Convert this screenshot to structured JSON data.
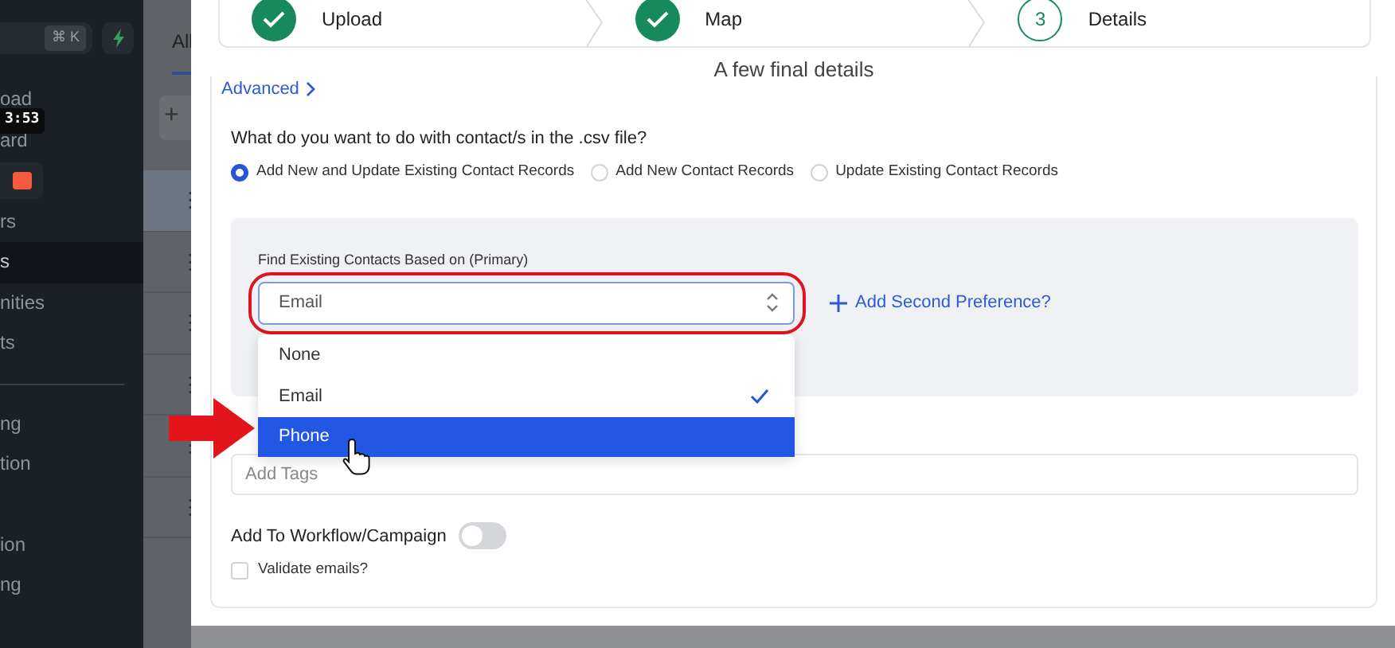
{
  "sidebar": {
    "shortcut": "⌘ K",
    "sections": [
      {
        "divider": false,
        "items": [
          {
            "kind": "text",
            "label": "oad",
            "selected": false
          },
          {
            "kind": "text",
            "label": "ard",
            "selected": false
          },
          {
            "kind": "square",
            "selected": false
          },
          {
            "kind": "text",
            "label": "rs",
            "selected": false
          },
          {
            "kind": "text",
            "label": "s",
            "selected": true
          },
          {
            "kind": "text",
            "label": "nities",
            "selected": false
          },
          {
            "kind": "text",
            "label": "ts",
            "selected": false
          }
        ]
      },
      {
        "divider": true,
        "items": [
          {
            "kind": "text",
            "label": "ng",
            "selected": false
          },
          {
            "kind": "text",
            "label": "tion",
            "selected": false
          }
        ]
      },
      {
        "divider": false,
        "items": [
          {
            "kind": "text",
            "label": "ion",
            "selected": false
          },
          {
            "kind": "text",
            "label": "ng",
            "selected": false
          }
        ]
      }
    ]
  },
  "video_timestamp": "3:53",
  "background_page": {
    "tab": "All",
    "add_button": "+",
    "row_menus": [
      "⋮",
      "⋮",
      "⋮",
      "⋮",
      "⋮",
      "⋮"
    ]
  },
  "stepper": [
    {
      "label": "Upload",
      "done": true
    },
    {
      "label": "Map",
      "done": true
    },
    {
      "label": "Details",
      "done": false,
      "number": "3"
    }
  ],
  "title": "A few final details",
  "advanced_link": "Advanced",
  "question": "What do you want to do with contact/s in the .csv file?",
  "actions": [
    {
      "label": "Add New and Update Existing Contact Records",
      "selected": true
    },
    {
      "label": "Add New Contact Records",
      "selected": false
    },
    {
      "label": "Update Existing Contact Records",
      "selected": false
    }
  ],
  "primary_match": {
    "label": "Find Existing Contacts Based on (Primary)",
    "value": "Email",
    "highlighted": true,
    "add_second": "Add Second Preference?",
    "options": [
      {
        "label": "None",
        "checked": false,
        "hovered": false
      },
      {
        "label": "Email",
        "checked": true,
        "hovered": false
      },
      {
        "label": "Phone",
        "checked": false,
        "hovered": true
      }
    ]
  },
  "tags": {
    "placeholder": "Add Tags"
  },
  "workflow": {
    "label": "Add To Workflow/Campaign",
    "on": false
  },
  "validate": {
    "label": "Validate emails?",
    "checked": false
  }
}
